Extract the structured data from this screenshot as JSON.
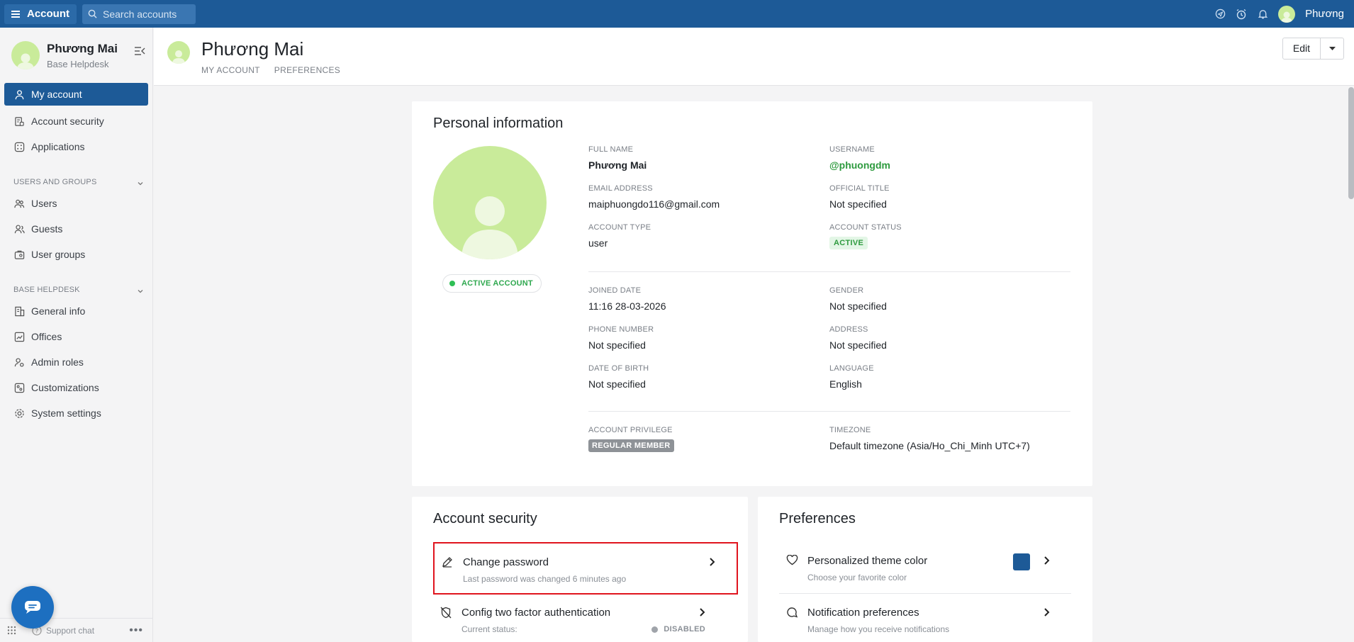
{
  "topbar": {
    "app_label": "Account",
    "search_placeholder": "Search accounts",
    "user_name": "Phương"
  },
  "sidebar": {
    "profile_name": "Phương Mai",
    "profile_org": "Base Helpdesk",
    "items_top": [
      "My account",
      "Account security",
      "Applications"
    ],
    "section_users": "USERS AND GROUPS",
    "items_users": [
      "Users",
      "Guests",
      "User groups"
    ],
    "section_base": "BASE HELPDESK",
    "items_base": [
      "General info",
      "Offices",
      "Admin roles",
      "Customizations",
      "System settings"
    ],
    "support_chat": "Support chat"
  },
  "header": {
    "title": "Phương Mai",
    "tabs": [
      "MY ACCOUNT",
      "PREFERENCES"
    ],
    "edit_label": "Edit"
  },
  "personal": {
    "title": "Personal information",
    "badge": "ACTIVE ACCOUNT",
    "full_name_label": "FULL NAME",
    "full_name": "Phương Mai",
    "username_label": "USERNAME",
    "username": "@phuongdm",
    "email_label": "EMAIL ADDRESS",
    "email": "maiphuongdo116@gmail.com",
    "official_title_label": "OFFICIAL TITLE",
    "official_title": "Not specified",
    "account_type_label": "ACCOUNT TYPE",
    "account_type": "user",
    "account_status_label": "ACCOUNT STATUS",
    "account_status": "ACTIVE",
    "joined_label": "JOINED DATE",
    "joined": "11:16 28-03-2026",
    "gender_label": "GENDER",
    "gender": "Not specified",
    "phone_label": "PHONE NUMBER",
    "phone": "Not specified",
    "address_label": "ADDRESS",
    "address": "Not specified",
    "dob_label": "DATE OF BIRTH",
    "dob": "Not specified",
    "language_label": "LANGUAGE",
    "language": "English",
    "privilege_label": "ACCOUNT PRIVILEGE",
    "privilege": "REGULAR MEMBER",
    "timezone_label": "TIMEZONE",
    "timezone": "Default timezone (Asia/Ho_Chi_Minh UTC+7)"
  },
  "security": {
    "title": "Account security",
    "change_password": "Change password",
    "change_password_desc": "Last password was changed 6 minutes ago",
    "two_factor": "Config two factor authentication",
    "two_factor_desc": "Current status:",
    "two_factor_status": "DISABLED"
  },
  "preferences": {
    "title": "Preferences",
    "theme": "Personalized theme color",
    "theme_desc": "Choose your favorite color",
    "theme_color": "#1d5a97",
    "notifications": "Notification preferences",
    "notifications_desc": "Manage how you receive notifications"
  },
  "colors": {
    "brand": "#1d5a97",
    "accent_green": "#2e9b3f",
    "highlight": "#e0141e"
  }
}
